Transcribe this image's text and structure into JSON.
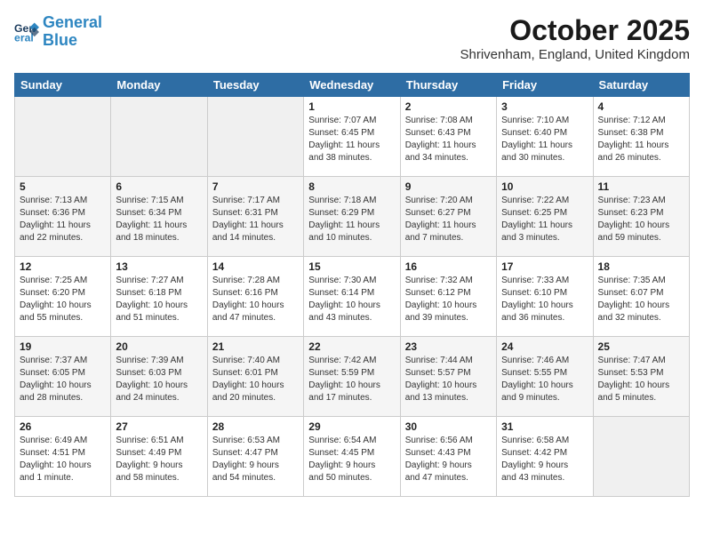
{
  "header": {
    "logo_line1": "General",
    "logo_line2": "Blue",
    "month": "October 2025",
    "location": "Shrivenham, England, United Kingdom"
  },
  "weekdays": [
    "Sunday",
    "Monday",
    "Tuesday",
    "Wednesday",
    "Thursday",
    "Friday",
    "Saturday"
  ],
  "weeks": [
    [
      {
        "day": "",
        "text": ""
      },
      {
        "day": "",
        "text": ""
      },
      {
        "day": "",
        "text": ""
      },
      {
        "day": "1",
        "text": "Sunrise: 7:07 AM\nSunset: 6:45 PM\nDaylight: 11 hours\nand 38 minutes."
      },
      {
        "day": "2",
        "text": "Sunrise: 7:08 AM\nSunset: 6:43 PM\nDaylight: 11 hours\nand 34 minutes."
      },
      {
        "day": "3",
        "text": "Sunrise: 7:10 AM\nSunset: 6:40 PM\nDaylight: 11 hours\nand 30 minutes."
      },
      {
        "day": "4",
        "text": "Sunrise: 7:12 AM\nSunset: 6:38 PM\nDaylight: 11 hours\nand 26 minutes."
      }
    ],
    [
      {
        "day": "5",
        "text": "Sunrise: 7:13 AM\nSunset: 6:36 PM\nDaylight: 11 hours\nand 22 minutes."
      },
      {
        "day": "6",
        "text": "Sunrise: 7:15 AM\nSunset: 6:34 PM\nDaylight: 11 hours\nand 18 minutes."
      },
      {
        "day": "7",
        "text": "Sunrise: 7:17 AM\nSunset: 6:31 PM\nDaylight: 11 hours\nand 14 minutes."
      },
      {
        "day": "8",
        "text": "Sunrise: 7:18 AM\nSunset: 6:29 PM\nDaylight: 11 hours\nand 10 minutes."
      },
      {
        "day": "9",
        "text": "Sunrise: 7:20 AM\nSunset: 6:27 PM\nDaylight: 11 hours\nand 7 minutes."
      },
      {
        "day": "10",
        "text": "Sunrise: 7:22 AM\nSunset: 6:25 PM\nDaylight: 11 hours\nand 3 minutes."
      },
      {
        "day": "11",
        "text": "Sunrise: 7:23 AM\nSunset: 6:23 PM\nDaylight: 10 hours\nand 59 minutes."
      }
    ],
    [
      {
        "day": "12",
        "text": "Sunrise: 7:25 AM\nSunset: 6:20 PM\nDaylight: 10 hours\nand 55 minutes."
      },
      {
        "day": "13",
        "text": "Sunrise: 7:27 AM\nSunset: 6:18 PM\nDaylight: 10 hours\nand 51 minutes."
      },
      {
        "day": "14",
        "text": "Sunrise: 7:28 AM\nSunset: 6:16 PM\nDaylight: 10 hours\nand 47 minutes."
      },
      {
        "day": "15",
        "text": "Sunrise: 7:30 AM\nSunset: 6:14 PM\nDaylight: 10 hours\nand 43 minutes."
      },
      {
        "day": "16",
        "text": "Sunrise: 7:32 AM\nSunset: 6:12 PM\nDaylight: 10 hours\nand 39 minutes."
      },
      {
        "day": "17",
        "text": "Sunrise: 7:33 AM\nSunset: 6:10 PM\nDaylight: 10 hours\nand 36 minutes."
      },
      {
        "day": "18",
        "text": "Sunrise: 7:35 AM\nSunset: 6:07 PM\nDaylight: 10 hours\nand 32 minutes."
      }
    ],
    [
      {
        "day": "19",
        "text": "Sunrise: 7:37 AM\nSunset: 6:05 PM\nDaylight: 10 hours\nand 28 minutes."
      },
      {
        "day": "20",
        "text": "Sunrise: 7:39 AM\nSunset: 6:03 PM\nDaylight: 10 hours\nand 24 minutes."
      },
      {
        "day": "21",
        "text": "Sunrise: 7:40 AM\nSunset: 6:01 PM\nDaylight: 10 hours\nand 20 minutes."
      },
      {
        "day": "22",
        "text": "Sunrise: 7:42 AM\nSunset: 5:59 PM\nDaylight: 10 hours\nand 17 minutes."
      },
      {
        "day": "23",
        "text": "Sunrise: 7:44 AM\nSunset: 5:57 PM\nDaylight: 10 hours\nand 13 minutes."
      },
      {
        "day": "24",
        "text": "Sunrise: 7:46 AM\nSunset: 5:55 PM\nDaylight: 10 hours\nand 9 minutes."
      },
      {
        "day": "25",
        "text": "Sunrise: 7:47 AM\nSunset: 5:53 PM\nDaylight: 10 hours\nand 5 minutes."
      }
    ],
    [
      {
        "day": "26",
        "text": "Sunrise: 6:49 AM\nSunset: 4:51 PM\nDaylight: 10 hours\nand 1 minute."
      },
      {
        "day": "27",
        "text": "Sunrise: 6:51 AM\nSunset: 4:49 PM\nDaylight: 9 hours\nand 58 minutes."
      },
      {
        "day": "28",
        "text": "Sunrise: 6:53 AM\nSunset: 4:47 PM\nDaylight: 9 hours\nand 54 minutes."
      },
      {
        "day": "29",
        "text": "Sunrise: 6:54 AM\nSunset: 4:45 PM\nDaylight: 9 hours\nand 50 minutes."
      },
      {
        "day": "30",
        "text": "Sunrise: 6:56 AM\nSunset: 4:43 PM\nDaylight: 9 hours\nand 47 minutes."
      },
      {
        "day": "31",
        "text": "Sunrise: 6:58 AM\nSunset: 4:42 PM\nDaylight: 9 hours\nand 43 minutes."
      },
      {
        "day": "",
        "text": ""
      }
    ]
  ]
}
